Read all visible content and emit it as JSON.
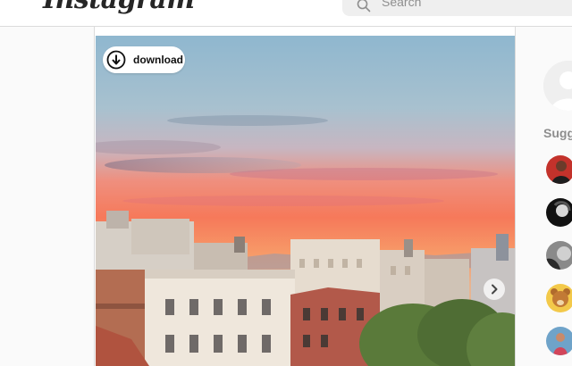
{
  "header": {
    "logo": "Instagram",
    "search": {
      "placeholder": "Search"
    }
  },
  "post": {
    "download_label": "download",
    "icons": {
      "download": "download-icon",
      "next": "chevron-right-icon"
    }
  },
  "sidebar": {
    "suggestions_title": "Suggestions For You",
    "suggestions": [
      {
        "avatar": "avatar-red"
      },
      {
        "avatar": "avatar-dark"
      },
      {
        "avatar": "avatar-gray"
      },
      {
        "avatar": "avatar-bear"
      },
      {
        "avatar": "avatar-blue"
      }
    ]
  },
  "colors": {
    "background": "#fafafa",
    "border": "#dbdbdb",
    "search_bg": "#efefef",
    "muted_text": "#8e8e8e"
  }
}
